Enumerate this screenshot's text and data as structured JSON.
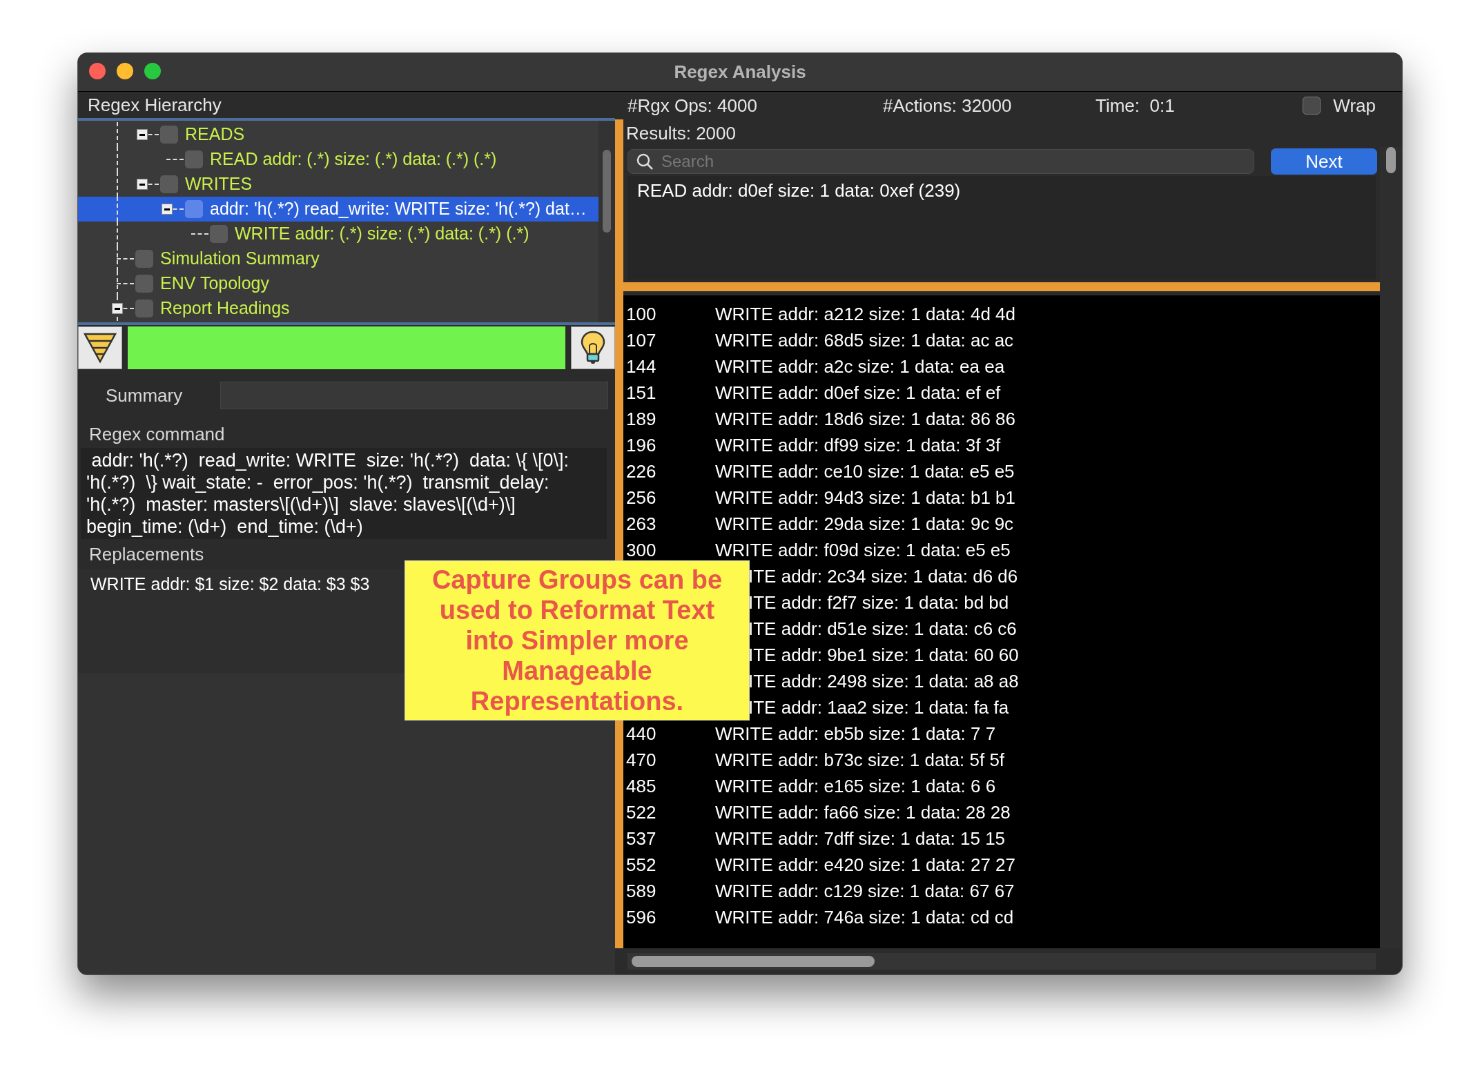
{
  "window": {
    "title": "Regex Analysis"
  },
  "hierarchy": {
    "title": "Regex Hierarchy",
    "tree": [
      {
        "children": [
          {
            "label": "READS",
            "expanded": true,
            "checked": false,
            "selected": false,
            "children": [
              {
                "label": "READ addr: (.*) size: (.*) data: (.*) (.*)",
                "checked": false,
                "selected": false
              }
            ]
          },
          {
            "label": "WRITES",
            "expanded": true,
            "checked": false,
            "selected": false,
            "children": [
              {
                "label": "addr: 'h(.*?)  read_write: WRITE  size: 'h(.*?)  dat…",
                "expanded": true,
                "checked": false,
                "selected": true,
                "children": [
                  {
                    "label": "WRITE addr: (.*) size: (.*) data: (.*) (.*)",
                    "checked": false,
                    "selected": false
                  }
                ]
              }
            ]
          }
        ]
      },
      {
        "label": "Simulation Summary",
        "checked": false,
        "selected": false
      },
      {
        "label": "ENV Topology",
        "checked": false,
        "selected": false
      },
      {
        "label": "Report Headings",
        "expanded": true,
        "checked": false,
        "selected": false
      }
    ]
  },
  "summary": {
    "label": "Summary"
  },
  "regex_command": {
    "label": "Regex command",
    "text": " addr: 'h(.*?)  read_write: WRITE  size: 'h(.*?)  data: \\{ \\[0\\]: 'h(.*?)  \\} wait_state: -  error_pos: 'h(.*?)  transmit_delay: 'h(.*?)  master: masters\\[(\\d+)\\]  slave: slaves\\[(\\d+)\\]  begin_time: (\\d+)  end_time: (\\d+)"
  },
  "replacements": {
    "label": "Replacements",
    "text": "WRITE addr: $1 size: $2 data: $3 $3"
  },
  "stats": [
    "#Rgx Ops: 4000",
    "#Actions: 32000",
    "Time:  0:1"
  ],
  "wrap": {
    "label": "Wrap",
    "checked": false
  },
  "results_label": "Results: 2000",
  "search": {
    "placeholder": "Search"
  },
  "next_button": "Next",
  "match_text": "READ addr: d0ef size: 1 data: 0xef (239)",
  "rows": [
    {
      "index": "100",
      "text": "WRITE addr: a212 size: 1 data: 4d 4d"
    },
    {
      "index": "107",
      "text": "WRITE addr: 68d5 size: 1 data: ac ac"
    },
    {
      "index": "144",
      "text": "WRITE addr: a2c size: 1 data: ea ea"
    },
    {
      "index": "151",
      "text": "WRITE addr: d0ef size: 1 data: ef ef"
    },
    {
      "index": "189",
      "text": "WRITE addr: 18d6 size: 1 data: 86 86"
    },
    {
      "index": "196",
      "text": "WRITE addr: df99 size: 1 data: 3f 3f"
    },
    {
      "index": "226",
      "text": "WRITE addr: ce10 size: 1 data: e5 e5"
    },
    {
      "index": "256",
      "text": "WRITE addr: 94d3 size: 1 data: b1 b1"
    },
    {
      "index": "263",
      "text": "WRITE addr: 29da size: 1 data: 9c 9c"
    },
    {
      "index": "300",
      "text": "WRITE addr: f09d size: 1 data: e5 e5"
    },
    {
      "text": "ITE addr: 2c34 size: 1 data: d6 d6"
    },
    {
      "text": "ITE addr: f2f7 size: 1 data: bd bd"
    },
    {
      "text": "ITE addr: d51e size: 1 data: c6 c6"
    },
    {
      "text": "ITE addr: 9be1 size: 1 data: 60 60"
    },
    {
      "text": "ITE addr: 2498 size: 1 data: a8 a8"
    },
    {
      "text": "ITE addr: 1aa2 size: 1 data: fa fa"
    },
    {
      "index": "440",
      "text": "WRITE addr: eb5b size: 1 data: 7 7"
    },
    {
      "index": "470",
      "text": "WRITE addr: b73c size: 1 data: 5f 5f"
    },
    {
      "index": "485",
      "text": "WRITE addr: e165 size: 1 data: 6 6"
    },
    {
      "index": "522",
      "text": "WRITE addr: fa66 size: 1 data: 28 28"
    },
    {
      "index": "537",
      "text": "WRITE addr: 7dff size: 1 data: 15 15"
    },
    {
      "index": "552",
      "text": "WRITE addr: e420 size: 1 data: 27 27"
    },
    {
      "index": "589",
      "text": "WRITE addr: c129 size: 1 data: 67 67"
    },
    {
      "index": "596",
      "text": "WRITE addr: 746a size: 1 data: cd cd"
    }
  ],
  "callout": "Capture Groups can be used to Reformat Text into Simpler more Manageable Representations."
}
